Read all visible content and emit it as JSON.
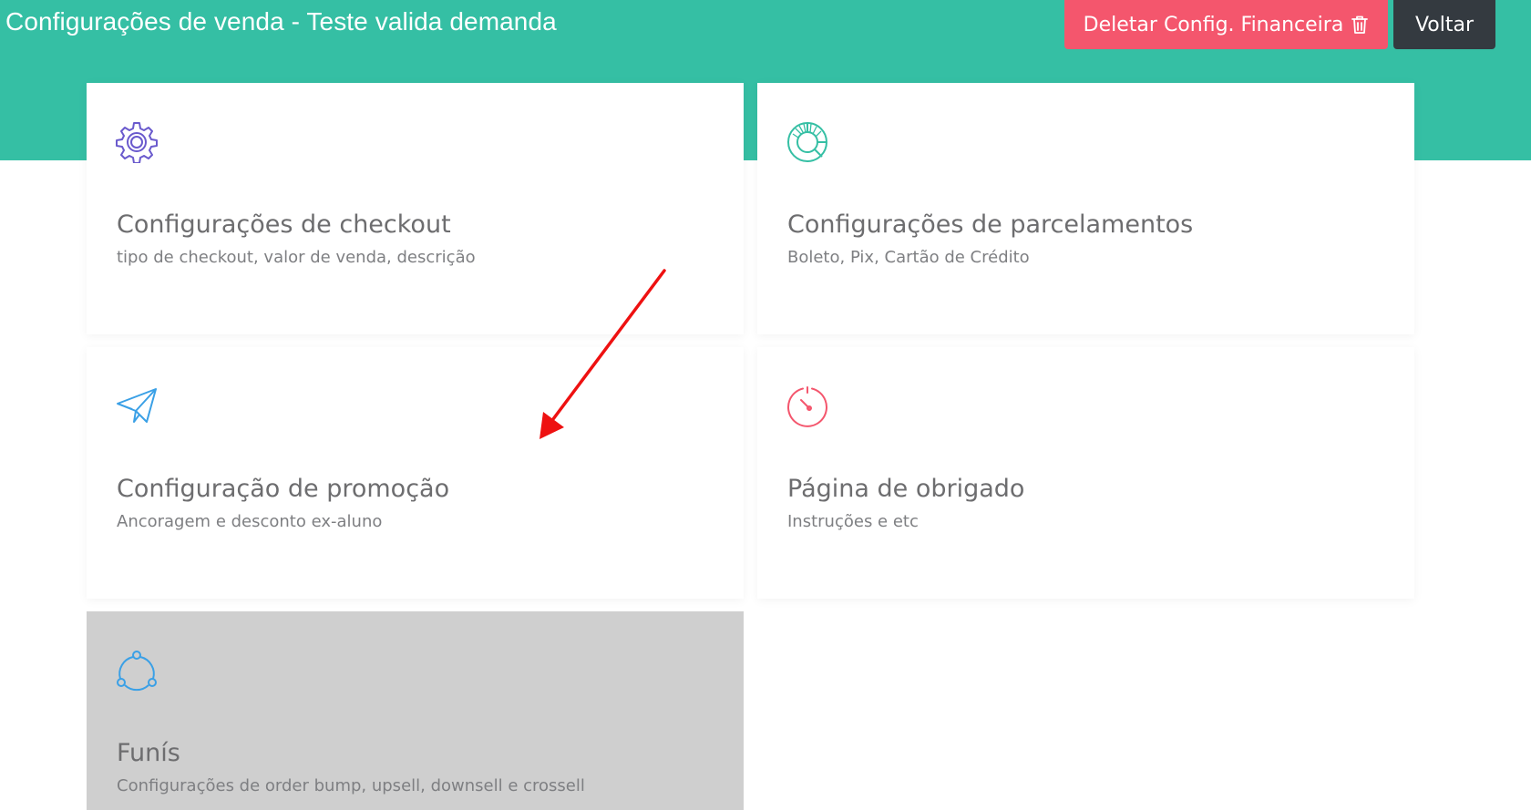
{
  "header": {
    "title": "Configurações de venda - Teste valida demanda",
    "delete_button_label": "Deletar Config. Financeira",
    "back_button_label": "Voltar"
  },
  "colors": {
    "header_bg": "#35bfa4",
    "delete_button": "#f4566d",
    "back_button": "#343a40",
    "annotation_arrow": "#ee1111"
  },
  "cards": [
    {
      "title": "Configurações de checkout",
      "description": "tipo de checkout, valor de venda, descrição",
      "icon": "gear-icon",
      "icon_color": "#6a5acd"
    },
    {
      "title": "Configurações de parcelamentos",
      "description": "Boleto, Pix, Cartão de Crédito",
      "icon": "pie-chart-icon",
      "icon_color": "#35bfa4"
    },
    {
      "title": "Configuração de promoção",
      "description": "Ancoragem e desconto ex-aluno",
      "icon": "paper-plane-icon",
      "icon_color": "#3aa0e6"
    },
    {
      "title": "Página de obrigado",
      "description": "Instruções e etc",
      "icon": "gauge-icon",
      "icon_color": "#f4566d"
    },
    {
      "title": "Funís",
      "description": "Configurações de order bump, upsell, downsell e crossell",
      "icon": "share-nodes-icon",
      "icon_color": "#3aa0e6",
      "disabled": true
    }
  ]
}
